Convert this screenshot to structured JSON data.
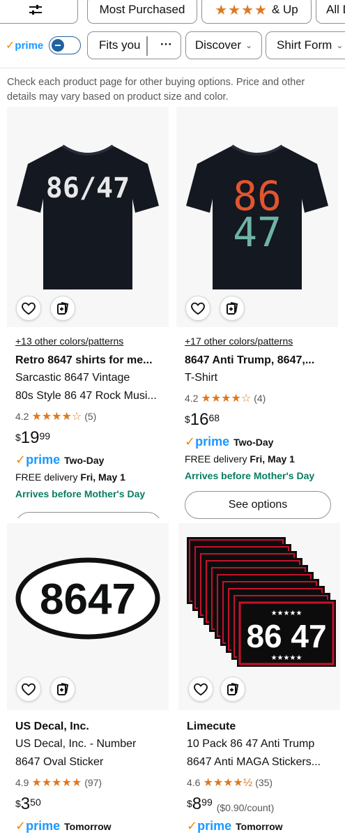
{
  "filters": {
    "row1": {
      "most_purchased": "Most Purchased",
      "stars": "★★★★",
      "and_up": "& Up",
      "all": "All D"
    },
    "row2": {
      "prime": "prime",
      "prime_toggle_on": false,
      "fits_you": "Fits you",
      "more": "···",
      "discover": "Discover",
      "shirt_form": "Shirt Form"
    }
  },
  "note": "Check each product page for other buying options. Price and other details may vary based on product size and color.",
  "products": [
    {
      "image_text": "86/47",
      "colors": "+13 other colors/patterns",
      "brand": "Retro 8647 shirts for me...",
      "title_lines": [
        "Sarcastic 8647 Vintage",
        "80s Style 86 47 Rock Musi..."
      ],
      "rating": "4.2",
      "stars": "★★★★☆",
      "reviews": "(5)",
      "price_symbol": "$",
      "price_whole": "19",
      "price_fraction": "99",
      "prime": "prime",
      "shipping": "Two-Day",
      "delivery_prefix": "FREE delivery ",
      "delivery_date": "Fri, May 1",
      "arrives": "Arrives before Mother's Day"
    },
    {
      "image_text_top": "86",
      "image_text_bottom": "47",
      "colors": "+17 other colors/patterns",
      "brand": "8647 Anti Trump, 8647,...",
      "title_lines": [
        "T-Shirt"
      ],
      "rating": "4.2",
      "stars": "★★★★☆",
      "reviews": "(4)",
      "price_symbol": "$",
      "price_whole": "16",
      "price_fraction": "68",
      "prime": "prime",
      "shipping": "Two-Day",
      "delivery_prefix": "FREE delivery ",
      "delivery_date": "Fri, May 1",
      "arrives": "Arrives before Mother's Day",
      "see_options": "See options"
    },
    {
      "image_text": "8647",
      "brand": "US Decal, Inc.",
      "title_lines": [
        "US Decal, Inc. - Number",
        "8647 Oval Sticker"
      ],
      "rating": "4.9",
      "stars": "★★★★★",
      "reviews": "(97)",
      "price_symbol": "$",
      "price_whole": "3",
      "price_fraction": "50",
      "prime": "prime",
      "shipping": "Tomorrow"
    },
    {
      "image_text": "86 47",
      "image_stars": "★★★★★",
      "brand": "Limecute",
      "title_lines": [
        "10 Pack 86 47 Anti Trump",
        "8647 Anti MAGA Stickers..."
      ],
      "rating": "4.6",
      "stars": "★★★★½",
      "reviews": "(35)",
      "price_symbol": "$",
      "price_whole": "8",
      "price_fraction": "99",
      "unit_price": "($0.90/count)",
      "prime": "prime",
      "shipping": "Tomorrow"
    }
  ],
  "colors": {
    "prime_blue": "#1a98ff",
    "prime_check": "#f08804",
    "star": "#de7921",
    "green": "#067d62",
    "toggle": "#2162a1"
  }
}
